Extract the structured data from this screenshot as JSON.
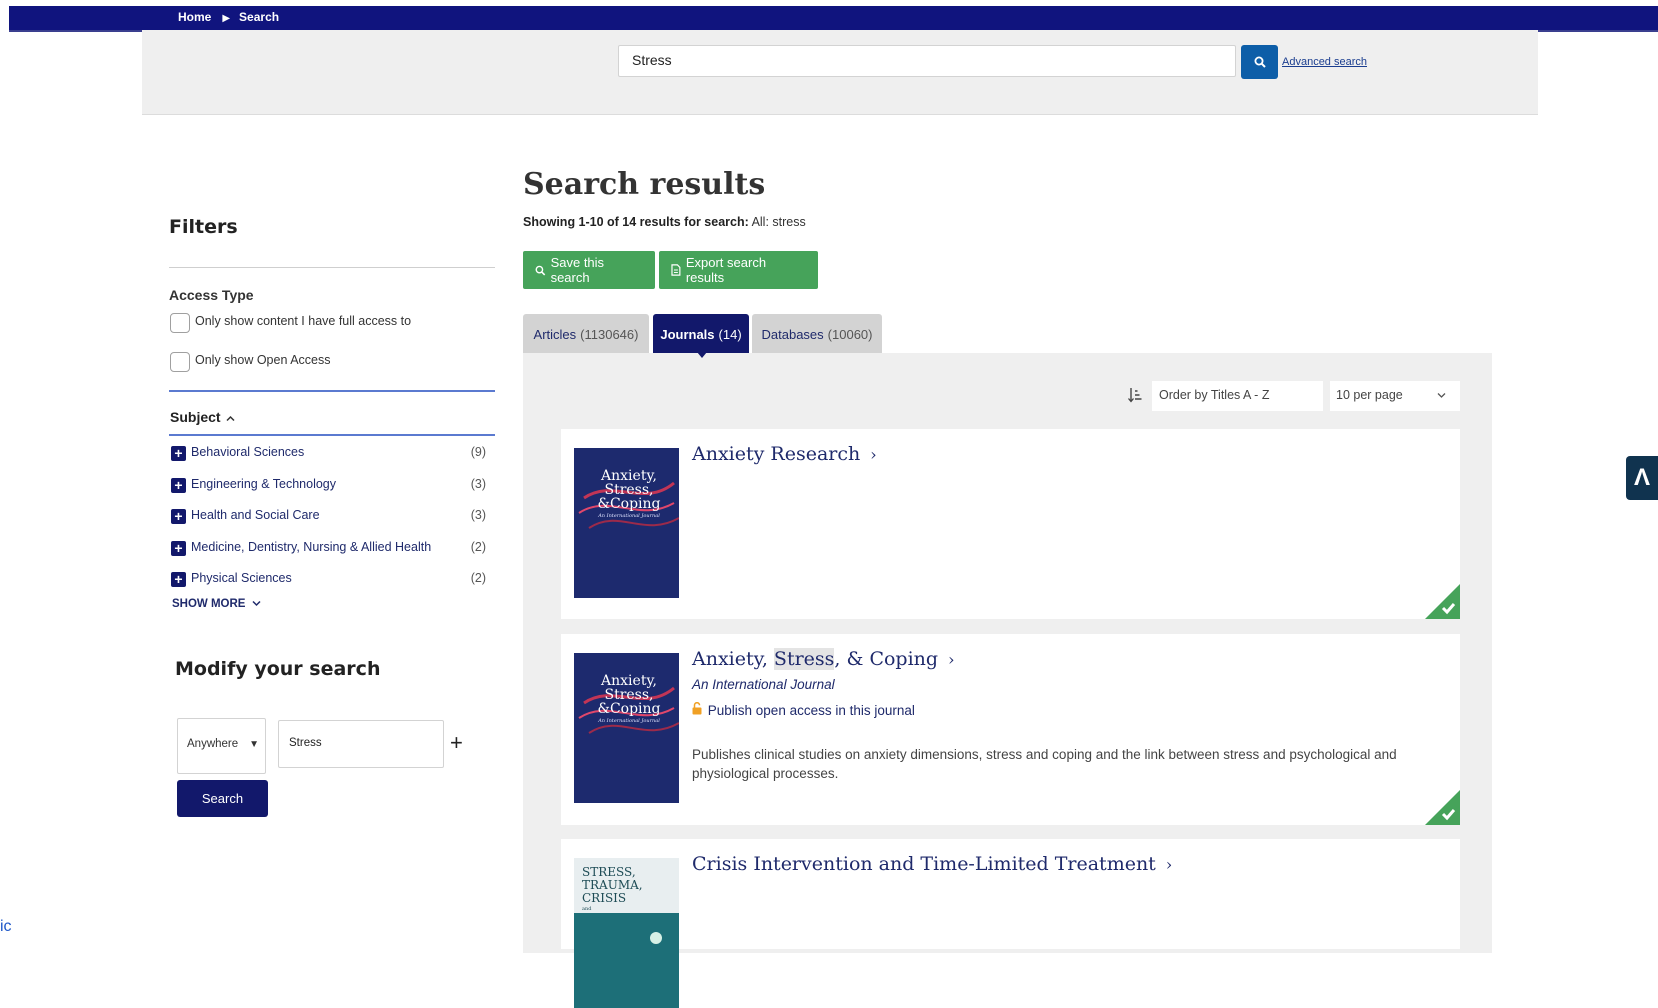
{
  "breadcrumb": {
    "home": "Home",
    "current": "Search"
  },
  "search": {
    "value": "Stress",
    "advanced_label": "Advanced search"
  },
  "filters": {
    "title": "Filters",
    "access_type": {
      "title": "Access Type",
      "options": [
        "Only show content I have full access to",
        "Only show Open Access"
      ]
    },
    "subject": {
      "title": "Subject",
      "items": [
        {
          "label": "Behavioral Sciences",
          "count": "(9)"
        },
        {
          "label": "Engineering & Technology",
          "count": "(3)"
        },
        {
          "label": "Health and Social Care",
          "count": "(3)"
        },
        {
          "label": "Medicine, Dentistry, Nursing & Allied Health",
          "count": "(2)"
        },
        {
          "label": "Physical Sciences",
          "count": "(2)"
        }
      ],
      "show_more": "SHOW MORE"
    }
  },
  "modify": {
    "title": "Modify your search",
    "field_select": "Anywhere",
    "term": "Stress",
    "add": "+",
    "button": "Search"
  },
  "results": {
    "title": "Search results",
    "showing_prefix": "Showing 1-10 of 14 results for search:",
    "showing_query": "All: stress",
    "save_label": "Save this search",
    "export_label": "Export search results",
    "tabs": [
      {
        "label": "Articles",
        "count": "(1130646)"
      },
      {
        "label": "Journals",
        "count": "(14)"
      },
      {
        "label": "Databases",
        "count": "(10060)"
      }
    ],
    "order": "Order by Titles A - Z",
    "per_page": "10 per page",
    "journals": [
      {
        "title": "Anxiety Research"
      },
      {
        "title_pre": "Anxiety, ",
        "title_hl": "Stress",
        "title_post": ", & Coping",
        "subtitle": "An International Journal",
        "open_access": "Publish open access in this journal",
        "description": "Publishes clinical studies on anxiety dimensions, stress and coping and the link between stress and psychological and physiological processes."
      },
      {
        "title": "Crisis Intervention and Time-Limited Treatment"
      }
    ],
    "covers": {
      "anxiety_lines": [
        "Anxiety,",
        "Stress,",
        "&Coping"
      ],
      "anxiety_sub": "An International Journal",
      "crisis_lines": [
        "STRESS,",
        "TRAUMA,",
        "CRISIS"
      ],
      "crisis_and": "and"
    }
  },
  "side_widget": "Λ",
  "edge_text": "ic",
  "colors": {
    "nav": "#10147e",
    "green": "#46a35a",
    "search_blue": "#0d5ea8",
    "link": "#1f2a6b"
  }
}
